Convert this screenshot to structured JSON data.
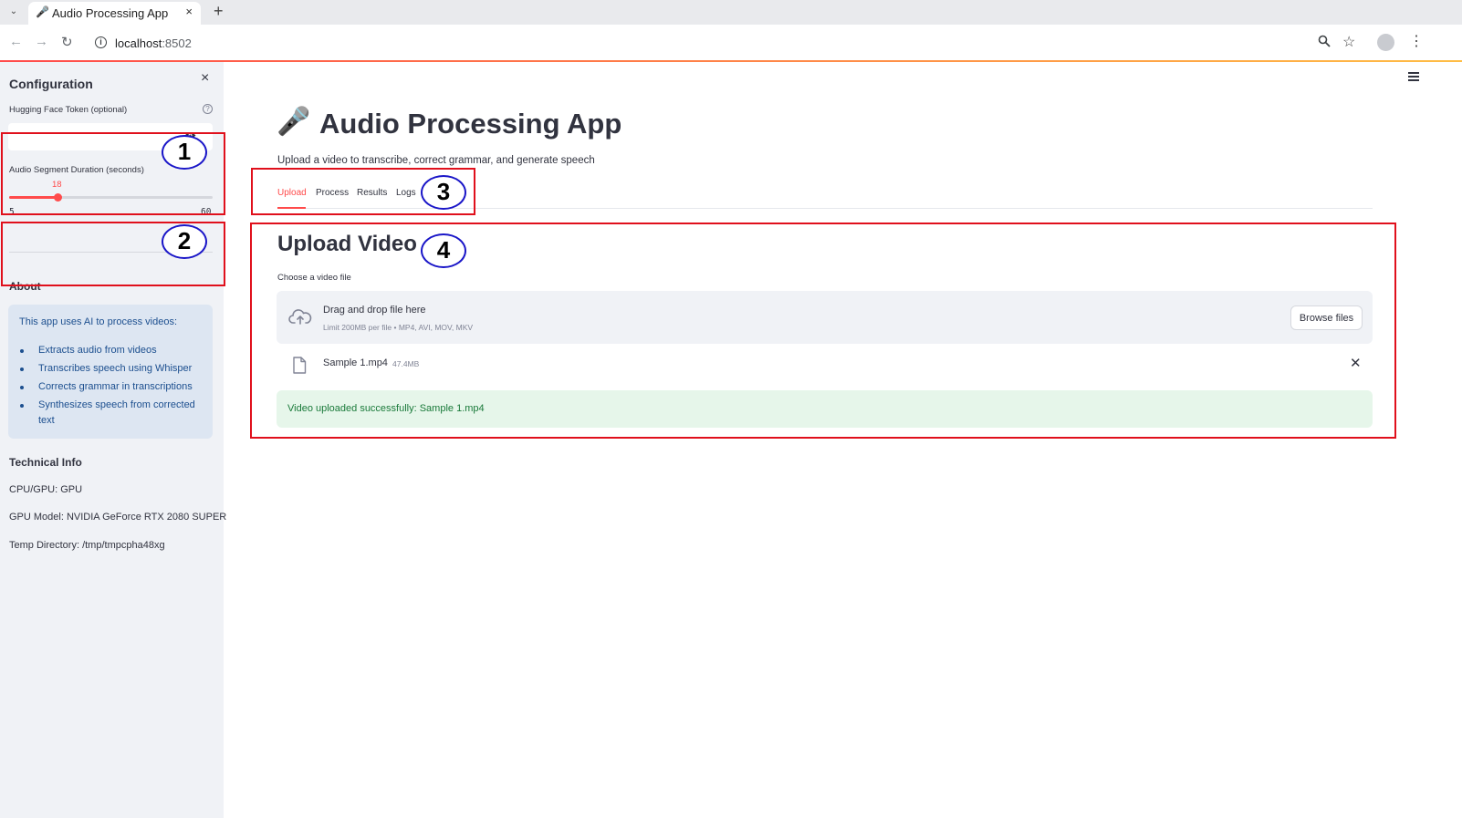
{
  "browser": {
    "tab_title": "Audio Processing App",
    "url_host": "localhost",
    "url_port": ":8502",
    "new_tab_label": "+",
    "tab_close_label": "×"
  },
  "sidebar": {
    "close_label": "×",
    "config_title": "Configuration",
    "token_label": "Hugging Face Token (optional)",
    "token_value": "",
    "segment_label": "Audio Segment Duration (seconds)",
    "slider": {
      "value": 18,
      "min": 5,
      "max": 60,
      "value_label": "18",
      "min_label": "5",
      "max_label": "60"
    },
    "about_title": "About",
    "about_intro": "This app uses AI to process videos:",
    "about_items": [
      "Extracts audio from videos",
      "Transcribes speech using Whisper",
      "Corrects grammar in transcriptions",
      "Synthesizes speech from corrected text"
    ],
    "tech_title": "Technical Info",
    "tech_cpu": "CPU/GPU: GPU",
    "tech_gpu": "GPU Model: NVIDIA GeForce RTX 2080 SUPER",
    "tech_tmp": "Temp Directory: /tmp/tmpcpha48xg"
  },
  "main": {
    "title": "Audio Processing App",
    "subtitle": "Upload a video to transcribe, correct grammar, and generate speech",
    "tabs": [
      "Upload",
      "Process",
      "Results",
      "Logs"
    ],
    "active_tab": "Upload",
    "section_title": "Upload Video",
    "choose_label": "Choose a video file",
    "dropzone_title": "Drag and drop file here",
    "dropzone_limit": "Limit 200MB per file • MP4, AVI, MOV, MKV",
    "browse_label": "Browse files",
    "file_name": "Sample 1.mp4",
    "file_size": "47.4MB",
    "success_message": "Video uploaded successfully: Sample 1.mp4"
  },
  "annotations": [
    "1",
    "2",
    "3",
    "4"
  ],
  "colors": {
    "accent": "#ff4b4b",
    "annotation_box": "#e0101c",
    "annotation_circle": "#1a16c8",
    "info_bg": "#dde6f2",
    "success_bg": "#e6f6ea"
  },
  "icons": {
    "tab_favicon": "microphone-icon",
    "title_icon": "microphone-icon",
    "help": "question-icon",
    "token_visibility": "eye-icon",
    "dropzone": "cloud-upload-icon",
    "file": "file-icon",
    "remove": "close-icon"
  }
}
